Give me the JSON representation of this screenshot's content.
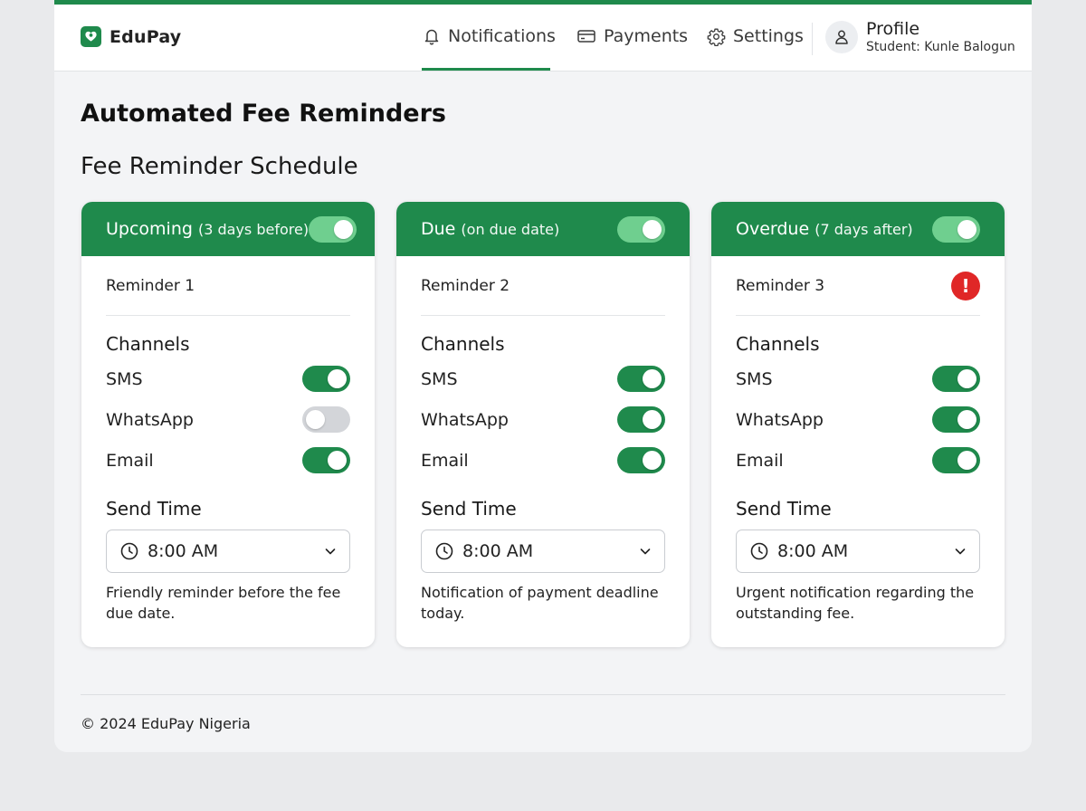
{
  "colors": {
    "brand_green": "#1f8a4c",
    "toggle_on": "#1f8a4c",
    "toggle_on_header": "#6fcf8f",
    "toggle_off": "#d3d5d9",
    "alert_red": "#e02727"
  },
  "brand": {
    "name": "EduPay",
    "logo_icon": "heart-hand-icon"
  },
  "nav": {
    "items": [
      {
        "label": "Notifications",
        "icon": "bell-icon",
        "active": true
      },
      {
        "label": "Payments",
        "icon": "credit-card-icon",
        "active": false
      },
      {
        "label": "Settings",
        "icon": "gear-icon",
        "active": false
      }
    ],
    "profile": {
      "label": "Profile",
      "subtitle": "Student: Kunle Balogun",
      "icon": "user-icon"
    }
  },
  "page": {
    "title": "Automated Fee Reminders",
    "section_title": "Fee Reminder Schedule"
  },
  "cards": [
    {
      "title": "Upcoming",
      "subtitle": "(3 days before)",
      "enabled": true,
      "reminder": "Reminder 1",
      "alert": false,
      "channels_label": "Channels",
      "channels": [
        {
          "name": "SMS",
          "on": true
        },
        {
          "name": "WhatsApp",
          "on": false
        },
        {
          "name": "Email",
          "on": true
        }
      ],
      "send_time_label": "Send Time",
      "send_time": "8:00 AM",
      "description": "Friendly reminder before the fee due date."
    },
    {
      "title": "Due",
      "subtitle": "(on due date)",
      "enabled": true,
      "reminder": "Reminder 2",
      "alert": false,
      "channels_label": "Channels",
      "channels": [
        {
          "name": "SMS",
          "on": true
        },
        {
          "name": "WhatsApp",
          "on": true
        },
        {
          "name": "Email",
          "on": true
        }
      ],
      "send_time_label": "Send Time",
      "send_time": "8:00 AM",
      "description": "Notification of payment deadline today."
    },
    {
      "title": "Overdue",
      "subtitle": "(7 days after)",
      "enabled": true,
      "reminder": "Reminder 3",
      "alert": true,
      "alert_symbol": "!",
      "channels_label": "Channels",
      "channels": [
        {
          "name": "SMS",
          "on": true
        },
        {
          "name": "WhatsApp",
          "on": true
        },
        {
          "name": "Email",
          "on": true
        }
      ],
      "send_time_label": "Send Time",
      "send_time": "8:00 AM",
      "description": "Urgent notification regarding the outstanding fee."
    }
  ],
  "footer": {
    "text": "© 2024 EduPay Nigeria"
  }
}
